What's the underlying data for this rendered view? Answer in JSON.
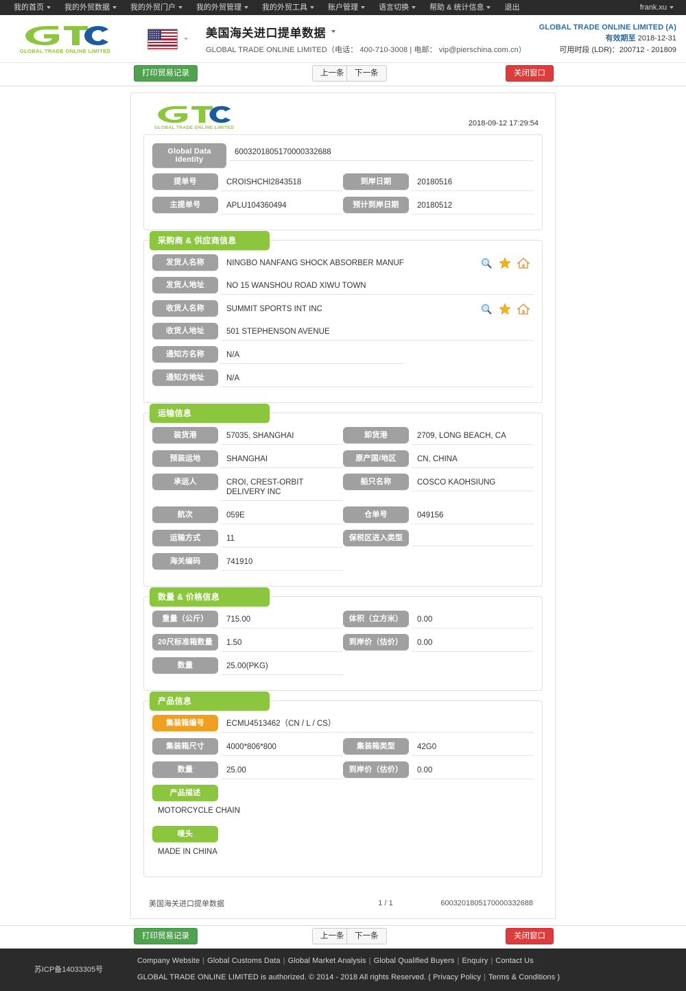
{
  "topnav": {
    "items": [
      {
        "label": "我的首页",
        "caret": true
      },
      {
        "label": "我的外贸数据",
        "caret": true
      },
      {
        "label": "我的外贸门户",
        "caret": true
      },
      {
        "label": "我的外贸管理",
        "caret": true
      },
      {
        "label": "我的外贸工具",
        "caret": true
      },
      {
        "label": "账户管理",
        "caret": true
      },
      {
        "label": "语言切换",
        "caret": true
      },
      {
        "label": "帮助 & 统计信息",
        "caret": true
      },
      {
        "label": "退出",
        "caret": false
      }
    ],
    "user": "frank.xu"
  },
  "header": {
    "logo_text": "GLOBAL TRADE ONLINE LIMITED",
    "flag": "us-flag-icon",
    "title": "美国海关进口提单数据",
    "subtitle": "GLOBAL TRADE ONLINE LIMITED（电话： 400-710-3008 | 电邮： vip@pierschina.com.cn）",
    "right_company": "GLOBAL TRADE ONLINE LIMITED (A)",
    "right_expiry_label": "有效期至",
    "right_expiry_value": "2018-12-31",
    "right_range": "可用时段 (LDR)：200712 - 201809"
  },
  "toolbar": {
    "print_label": "打印贸易记录",
    "prev_label": "上一条",
    "next_label": "下一条",
    "close_label": "关闭窗口"
  },
  "document": {
    "logo_text": "GLOBAL TRADE ONLINE LIMITED",
    "date": "2018-09-12 17:29:54",
    "identity": {
      "label": "Global Data Identity",
      "value": "6003201805170000332688"
    },
    "bill": {
      "bill_no_label": "提单号",
      "bill_no_value": "CROISHCHI2843518",
      "arrival_date_label": "到岸日期",
      "arrival_date_value": "20180516",
      "master_bill_label": "主提单号",
      "master_bill_value": "APLU104360494",
      "est_arrival_label": "预计到岸日期",
      "est_arrival_value": "20180512"
    },
    "parties": {
      "title": "采购商 & 供应商信息",
      "shipper_name_label": "发货人名称",
      "shipper_name_value": "NINGBO NANFANG SHOCK ABSORBER MANUF",
      "shipper_addr_label": "发货人地址",
      "shipper_addr_value": "NO 15 WANSHOU ROAD XIWU TOWN",
      "consignee_name_label": "收货人名称",
      "consignee_name_value": "SUMMIT SPORTS INT INC",
      "consignee_addr_label": "收货人地址",
      "consignee_addr_value": "501 STEPHENSON AVENUE",
      "notify_name_label": "通知方名称",
      "notify_name_value": "N/A",
      "notify_addr_label": "通知方地址",
      "notify_addr_value": "N/A"
    },
    "transport": {
      "title": "运输信息",
      "load_port_label": "装货港",
      "load_port_value": "57035, SHANGHAI",
      "discharge_port_label": "卸货港",
      "discharge_port_value": "2709, LONG BEACH, CA",
      "preload_label": "预装运地",
      "preload_value": "SHANGHAI",
      "origin_label": "原产国/地区",
      "origin_value": "CN, CHINA",
      "carrier_label": "承运人",
      "carrier_value": "CROI, CREST-ORBIT DELIVERY INC",
      "vessel_label": "船只名称",
      "vessel_value": "COSCO KAOHSIUNG",
      "voyage_label": "航次",
      "voyage_value": "059E",
      "warehouse_label": "仓单号",
      "warehouse_value": "049156",
      "transport_mode_label": "运输方式",
      "transport_mode_value": "11",
      "bonded_label": "保税区进入类型",
      "bonded_value": "",
      "customs_code_label": "海关编码",
      "customs_code_value": "741910"
    },
    "quantity": {
      "title": "数量 & 价格信息",
      "weight_label": "重量（公斤）",
      "weight_value": "715.00",
      "volume_label": "体积（立方米）",
      "volume_value": "0.00",
      "teu_label": "20尺标准箱数量",
      "teu_value": "1.50",
      "cif_label": "到岸价（估价）",
      "cif_value": "0.00",
      "qty_label": "数量",
      "qty_value": "25.00(PKG)"
    },
    "product": {
      "title": "产品信息",
      "container_no_label": "集装箱编号",
      "container_no_value": "ECMU4513462（CN / L / CS）",
      "container_size_label": "集装箱尺寸",
      "container_size_value": "4000*806*800",
      "container_type_label": "集装箱类型",
      "container_type_value": "42G0",
      "qty_label": "数量",
      "qty_value": "25.00",
      "cif_label": "到岸价（估价）",
      "cif_value": "0.00",
      "desc_label": "产品描述",
      "desc_value": "MOTORCYCLE CHAIN",
      "mark_label": "唛头",
      "mark_value": "MADE IN CHINA"
    },
    "footer": {
      "source": "美国海关进口提单数据",
      "page": "1 / 1",
      "identity": "6003201805170000332688"
    }
  },
  "footer": {
    "icp": "苏ICP备14033305号",
    "links": [
      "Company Website",
      "Global Customs Data",
      "Global Market Analysis",
      "Global Qualified Buyers",
      "Enquiry",
      "Contact Us"
    ],
    "copy_prefix": "GLOBAL TRADE ONLINE LIMITED is authorized. © 2014 - 2018 All rights Reserved.  (",
    "copy_link1": "Privacy Policy",
    "copy_link2": "Terms & Conditions",
    "copy_suffix": ")"
  },
  "colors": {
    "brand_green": "#8cc63e",
    "brand_blue": "#1b5ba0",
    "label_gray": "#a0a0a0",
    "accent_orange": "#f0a020",
    "danger_red": "#dc3c3c",
    "nav_dark": "#2b2b2b"
  }
}
